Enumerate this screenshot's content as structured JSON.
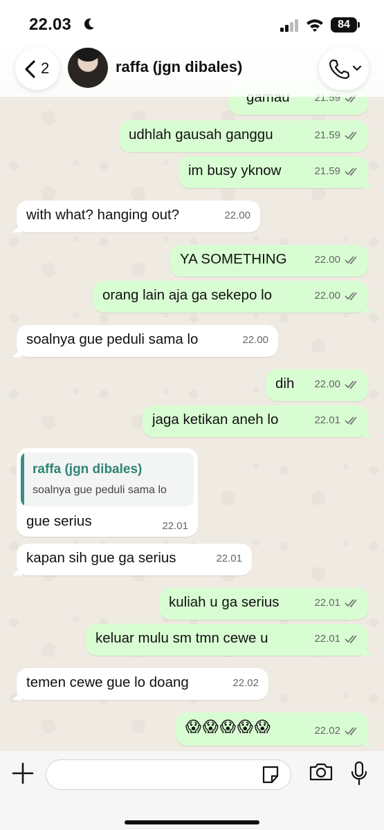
{
  "status_bar": {
    "time": "22.03",
    "battery": "84"
  },
  "header": {
    "back_count": "2",
    "contact_name": "raffa (jgn dibales)"
  },
  "messages": [
    {
      "text": "gamau",
      "time": "21.59"
    },
    {
      "text": "udhlah gausah ganggu",
      "time": "21.59"
    },
    {
      "text": "im busy yknow",
      "time": "21.59"
    },
    {
      "text": "with what? hanging out?",
      "time": "22.00"
    },
    {
      "text": "YA SOMETHING",
      "time": "22.00"
    },
    {
      "text": "orang lain aja ga sekepo lo",
      "time": "22.00"
    },
    {
      "text": "soalnya gue peduli sama lo",
      "time": "22.00"
    },
    {
      "text": "dih",
      "time": "22.00"
    },
    {
      "text": "jaga ketikan aneh lo",
      "time": "22.01"
    },
    {
      "text": "gue serius",
      "time": "22.01",
      "quote_author": "raffa (jgn dibales)",
      "quote_text": "soalnya gue peduli sama lo"
    },
    {
      "text": "kapan sih gue ga serius",
      "time": "22.01"
    },
    {
      "text": "kuliah u ga serius",
      "time": "22.01"
    },
    {
      "text": "keluar mulu sm tmn cewe u",
      "time": "22.01"
    },
    {
      "text": "temen cewe gue lo doang",
      "time": "22.02"
    },
    {
      "text": "😱😱😱😱😱",
      "time": "22.02"
    }
  ],
  "input_bar": {
    "placeholder": ""
  },
  "colors": {
    "outgoing_bubble": "#d9fdd3",
    "incoming_bubble": "#ffffff",
    "quote_accent": "#2f8475",
    "wallpaper": "#efeae2"
  },
  "icons": [
    "moon-icon",
    "signal-icon",
    "wifi-icon",
    "back-chevron-icon",
    "phone-icon",
    "chevron-down-icon",
    "double-check-icon",
    "plus-icon",
    "sticker-icon",
    "camera-icon",
    "mic-icon"
  ]
}
